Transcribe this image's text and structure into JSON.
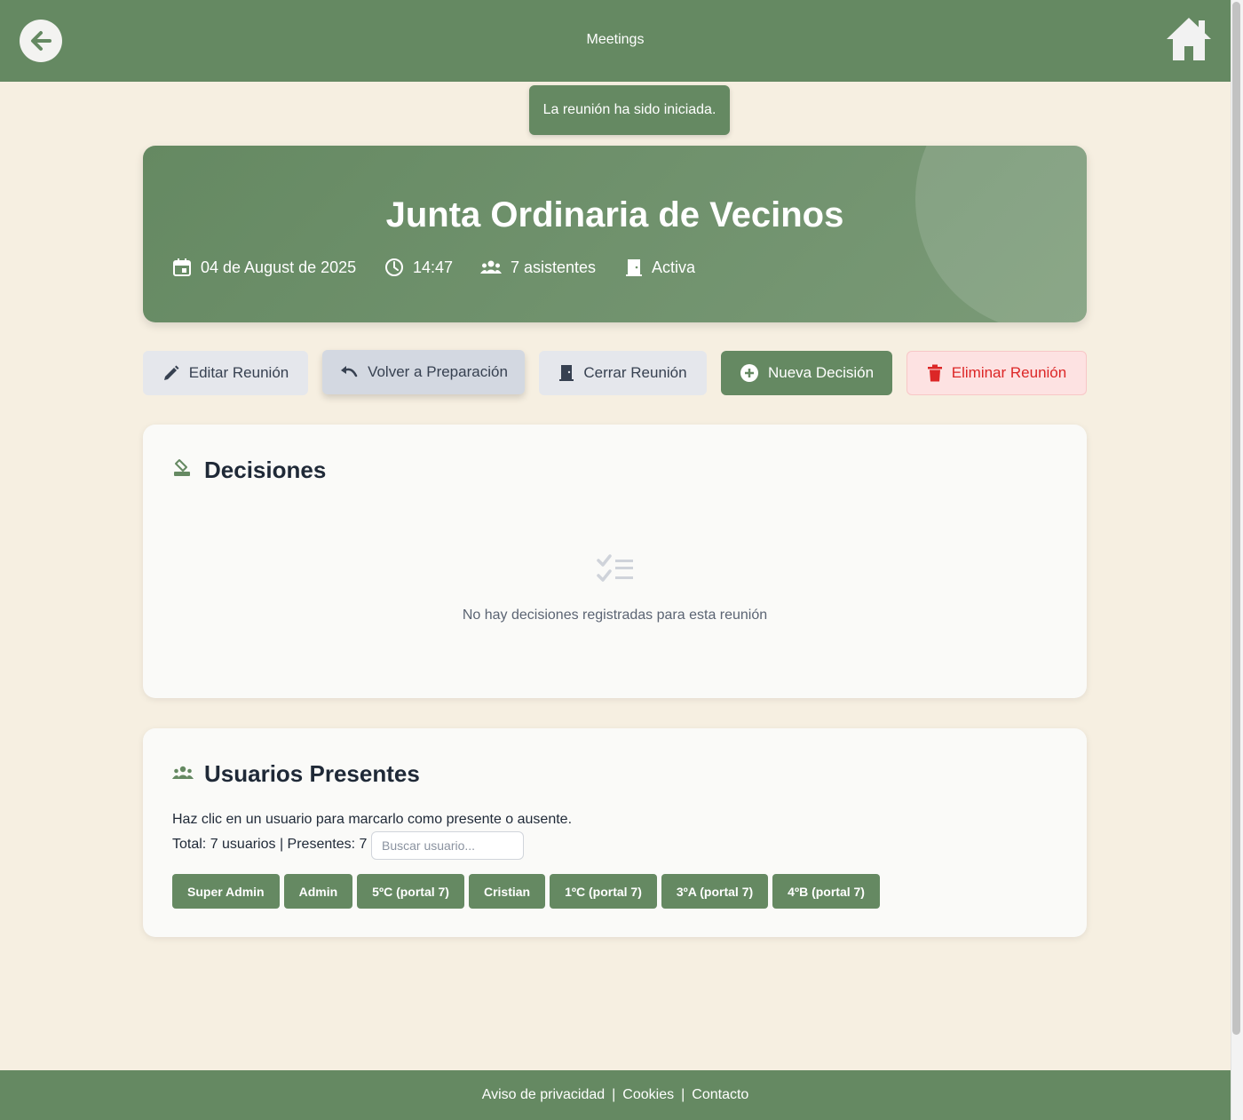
{
  "header": {
    "title": "Meetings",
    "back_icon": "arrow-left-icon",
    "home_icon": "home-icon"
  },
  "toast": {
    "message": "La reunión ha sido iniciada."
  },
  "meeting": {
    "title": "Junta Ordinaria de Vecinos",
    "date": "04 de August de 2025",
    "time": "14:47",
    "attendees": "7 asistentes",
    "status": "Activa"
  },
  "actions": {
    "edit": "Editar Reunión",
    "back_to_prep": "Volver a Preparación",
    "close": "Cerrar Reunión",
    "new_decision": "Nueva Decisión",
    "delete": "Eliminar Reunión"
  },
  "decisions": {
    "title": "Decisiones",
    "empty": "No hay decisiones registradas para esta reunión"
  },
  "users": {
    "title": "Usuarios Presentes",
    "hint": "Haz clic en un usuario para marcarlo como presente o ausente.",
    "totals": "Total: 7 usuarios | Presentes: 7",
    "search_placeholder": "Buscar usuario...",
    "list": [
      "Super Admin",
      "Admin",
      "5ºC (portal 7)",
      "Cristian",
      "1ºC (portal 7)",
      "3ºA (portal 7)",
      "4ºB (portal 7)"
    ]
  },
  "footer": {
    "privacy": "Aviso de privacidad",
    "sep": "|",
    "cookies": "Cookies",
    "contact": "Contacto"
  },
  "colors": {
    "primary": "#658962",
    "background": "#f6efe1",
    "danger": "#dc2626"
  }
}
